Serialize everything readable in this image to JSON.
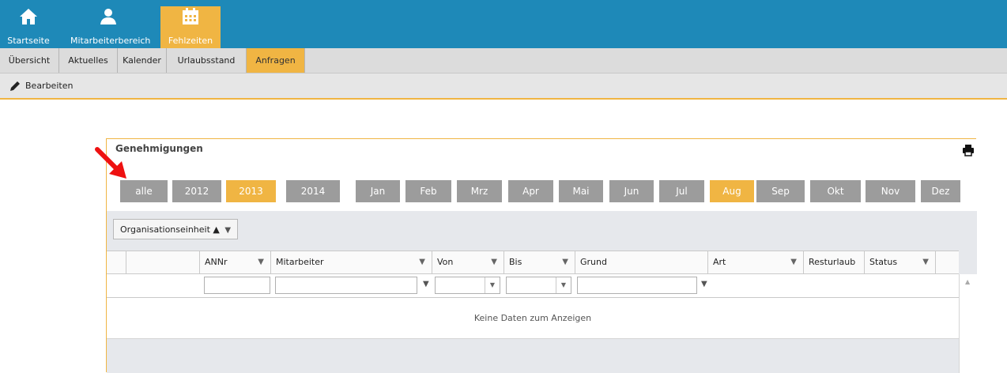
{
  "topnav": {
    "items": [
      {
        "label": "Startseite",
        "icon": "home-icon"
      },
      {
        "label": "Mitarbeiterbereich",
        "icon": "user-icon"
      },
      {
        "label": "Fehlzeiten",
        "icon": "calendar-icon",
        "active": true
      }
    ]
  },
  "subtabs": [
    "Übersicht",
    "Aktuelles",
    "Kalender",
    "Urlaubsstand",
    "Anfragen"
  ],
  "toolbar": {
    "edit_label": "Bearbeiten",
    "icon": "pencil-icon"
  },
  "panel": {
    "title": "Genehmigungen",
    "print_icon": "printer-icon",
    "years": [
      "alle",
      "2012",
      "2013",
      "2014"
    ],
    "selected_year": "2013",
    "months": [
      "Jan",
      "Feb",
      "Mrz",
      "Apr",
      "Mai",
      "Jun",
      "Jul",
      "Aug",
      "Sep",
      "Okt",
      "Nov",
      "Dez"
    ],
    "selected_month": "Aug"
  },
  "grid": {
    "group_label": "Organisationseinheit ▲",
    "columns": [
      "ANNr",
      "Mitarbeiter",
      "Von",
      "Bis",
      "Grund",
      "Art",
      "Resturlaub",
      "Status"
    ],
    "empty_text": "Keine Daten zum Anzeigen"
  },
  "colors": {
    "nav_blue": "#1e89b8",
    "accent_orange": "#f0b543",
    "button_gray": "#9c9c9c",
    "arrow_red": "#ee1111"
  }
}
